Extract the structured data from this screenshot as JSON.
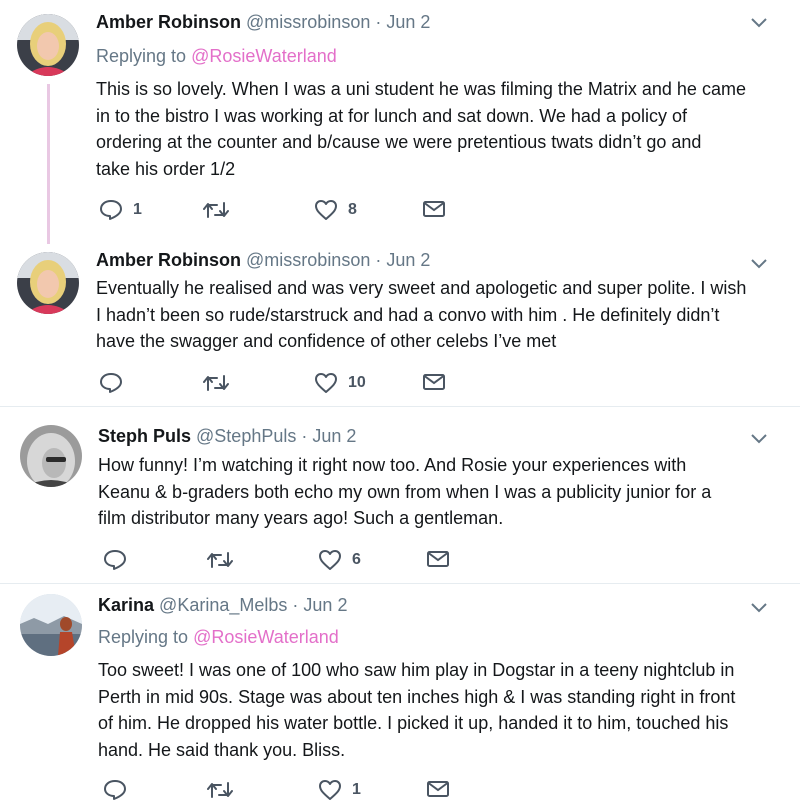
{
  "tweets": [
    {
      "name": "Amber Robinson",
      "handle": "@missrobinson",
      "dot": "·",
      "date": "Jun 2",
      "reply_prefix": "Replying to",
      "reply_to": "@RosieWaterland",
      "lines": [
        "This is so lovely. When I was a uni student he was filming the Matrix and he came",
        "in to the bistro I was working at for lunch and sat down. We had a policy of",
        "ordering at the counter and b/cause we were pretentious twats didn’t go and",
        "take his order 1/2"
      ],
      "replies": "1",
      "retweets": "",
      "likes": "8"
    },
    {
      "name": "Amber Robinson",
      "handle": "@missrobinson",
      "dot": "·",
      "date": "Jun 2",
      "lines": [
        "Eventually he realised and was very sweet and apologetic and super polite. I wish",
        "I hadn’t been so rude/starstruck and had a convo with him . He definitely didn’t",
        "have the swagger and confidence of other celebs I’ve met"
      ],
      "replies": "",
      "retweets": "",
      "likes": "10"
    },
    {
      "name": "Steph Puls",
      "handle": "@StephPuls",
      "dot": "·",
      "date": "Jun 2",
      "lines": [
        "How funny! I’m watching it right now too. And Rosie your experiences with",
        "Keanu & b-graders both echo my own from when I was a publicity junior for a",
        "film distributor many years ago! Such a gentleman."
      ],
      "replies": "",
      "retweets": "",
      "likes": "6"
    },
    {
      "name": "Karina",
      "handle": "@Karina_Melbs",
      "dot": "·",
      "date": "Jun 2",
      "reply_prefix": "Replying to",
      "reply_to": "@RosieWaterland",
      "lines": [
        "Too sweet! I was one of 100 who saw him play in Dogstar in a teeny nightclub in",
        "Perth in mid 90s. Stage was about ten inches high & I was standing right in front",
        "of him. He dropped his water bottle. I picked it up, handed it to him, touched his",
        "hand. He said thank you. Bliss."
      ],
      "replies": "",
      "retweets": "",
      "likes": "1"
    }
  ],
  "colors": {
    "mention": "#e36fc9",
    "thread_line": "#e9c8e3",
    "icon": "#4a5562",
    "muted": "#657786"
  },
  "icons": [
    "reply-icon",
    "retweet-icon",
    "like-icon",
    "message-icon",
    "chevron-down-icon"
  ]
}
